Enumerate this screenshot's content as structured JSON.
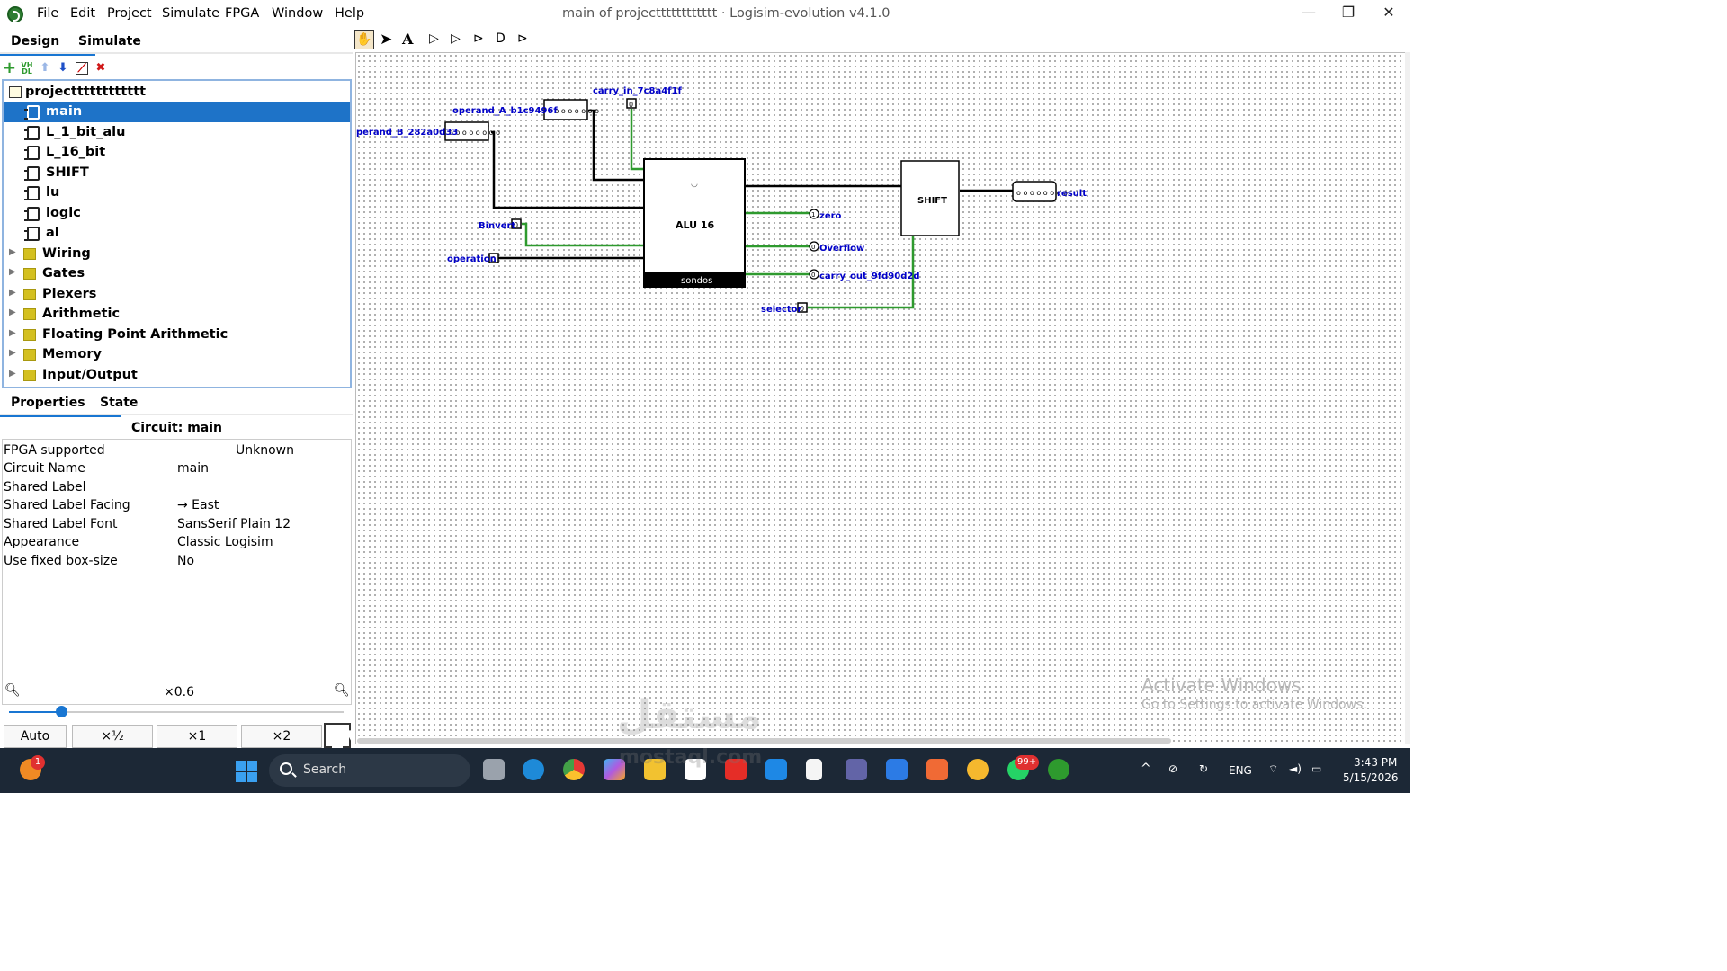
{
  "window": {
    "title": "main of projectttttttttttt · Logisim-evolution v4.1.0",
    "menu": [
      "File",
      "Edit",
      "Project",
      "Simulate",
      "FPGA",
      "Window",
      "Help"
    ],
    "controls": [
      "—",
      "❐",
      "✕"
    ]
  },
  "left_tabs": {
    "design": "Design",
    "simulate": "Simulate"
  },
  "project_tree": {
    "project_name": "projectttttttttttt",
    "circuits": [
      "main",
      "L_1_bit_alu",
      "L_16_bit",
      "SHIFT",
      "lu",
      "logic",
      "al"
    ],
    "selected": "main",
    "libraries": [
      "Wiring",
      "Gates",
      "Plexers",
      "Arithmetic",
      "Floating Point Arithmetic",
      "Memory",
      "Input/Output"
    ]
  },
  "props_tabs": {
    "properties": "Properties",
    "state": "State"
  },
  "properties": {
    "title": "Circuit: main",
    "rows": [
      {
        "key": "FPGA supported",
        "value": "Unknown"
      },
      {
        "key": "Circuit Name",
        "value": "main"
      },
      {
        "key": "Shared Label",
        "value": ""
      },
      {
        "key": "Shared Label Facing",
        "value": "→ East"
      },
      {
        "key": "Shared Label Font",
        "value": "SansSerif Plain 12"
      },
      {
        "key": "Appearance",
        "value": "Classic Logisim"
      },
      {
        "key": "Use fixed box-size",
        "value": "No"
      }
    ]
  },
  "zoom": {
    "level_label": "×0.6",
    "level": 0.6,
    "buttons": [
      "Auto",
      "×½",
      "×1",
      "×2"
    ]
  },
  "circuit": {
    "pins": {
      "operand_a": "operand_A_b1c9496f",
      "operand_b": "perand_B_282a0d33",
      "carry_in": "carry_in_7c8a4f1f",
      "binvert": "Binvert",
      "operation": "operation",
      "selector": "selector",
      "zero": "zero",
      "overflow": "Overflow",
      "carry_out": "carry_out_9fd90d2d",
      "result": "result"
    },
    "alu": {
      "name": "ALU 16",
      "label": "sondos"
    },
    "shift": {
      "name": "SHIFT"
    },
    "pin_values": {
      "binvert": "0",
      "carry_in": "0",
      "selector": "0",
      "operation": "0",
      "zero": "1",
      "overflow": "0",
      "carry_out": "0"
    }
  },
  "activate_windows": {
    "line1": "Activate Windows",
    "line2": "Go to Settings to activate Windows."
  },
  "watermark": {
    "arabic": "مستقل",
    "latin": "mostaql.com"
  },
  "taskbar": {
    "search": "Search",
    "badge_left": "1",
    "badge_whatsapp": "99+",
    "lang": "ENG",
    "time": "3:43 PM",
    "date": "5/15/2026"
  }
}
